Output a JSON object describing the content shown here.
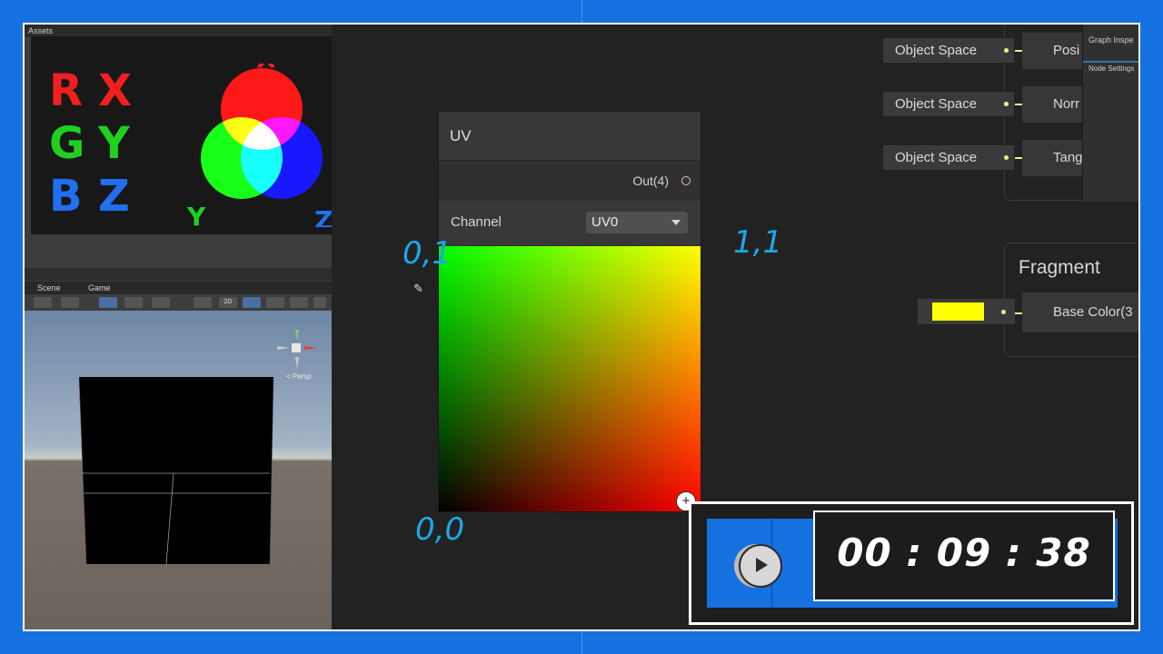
{
  "assets_panel": {
    "title": "Assets"
  },
  "rgb_legend": {
    "letters": [
      {
        "text": "R",
        "color": "#f02020"
      },
      {
        "text": "X",
        "color": "#f02020"
      },
      {
        "text": "G",
        "color": "#20d020"
      },
      {
        "text": "Y",
        "color": "#20d020"
      },
      {
        "text": "B",
        "color": "#2070f0"
      },
      {
        "text": "Z",
        "color": "#2070f0"
      }
    ],
    "venn_labels": {
      "top": "X",
      "left": "Y",
      "right": "Z"
    },
    "venn_label_colors": {
      "top": "#f02020",
      "left": "#20d020",
      "right": "#2070f0"
    }
  },
  "scene_panel": {
    "tabs": [
      "Scene",
      "Game"
    ],
    "toolbar_2d": "2D",
    "persp_label": "< Persp"
  },
  "uv_node": {
    "title": "UV",
    "output_label": "Out(4)",
    "channel_label": "Channel",
    "channel_value": "UV0"
  },
  "annotations": {
    "top_left": "0,1",
    "top_right": "1,1",
    "bottom_left": "0,0"
  },
  "vertex_block": {
    "object_space_label": "Object Space",
    "slots": [
      "Posi",
      "Norr",
      "Tang"
    ]
  },
  "graph_inspector": {
    "title": "Graph Inspe",
    "tab": "Node Settings"
  },
  "fragment_block": {
    "title": "Fragment",
    "base_color_label": "Base Color(3",
    "swatch_color": "#ffff00"
  },
  "timer": {
    "time": "00 : 09 : 38"
  },
  "icons": [
    "play-icon",
    "add-icon",
    "pencil-icon",
    "transform-gizmo-icon"
  ]
}
